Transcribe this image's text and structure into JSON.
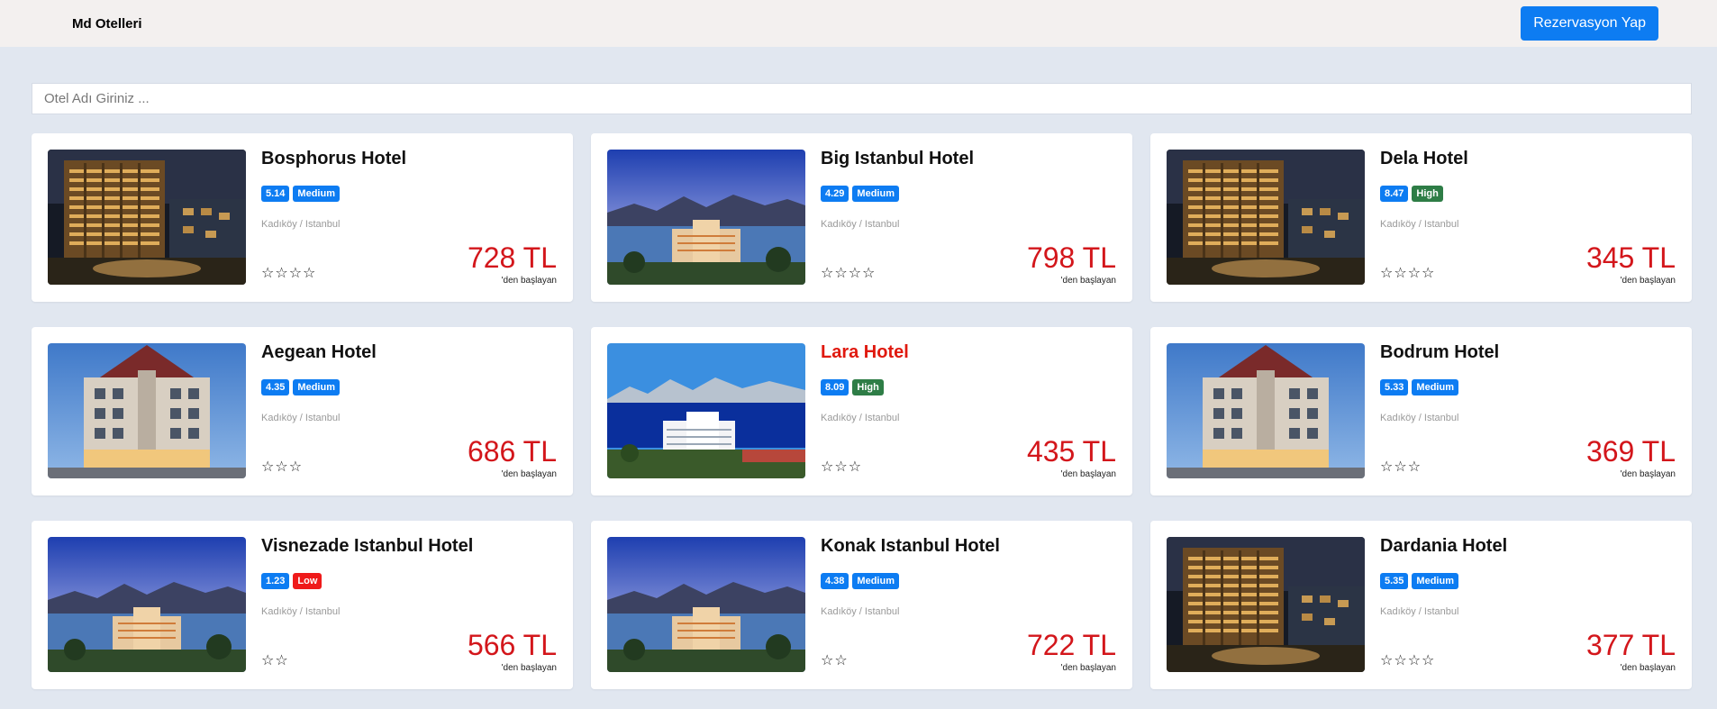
{
  "header": {
    "brand": "Md Otelleri",
    "cta_label": "Rezervasyon Yap"
  },
  "search": {
    "placeholder": "Otel Adı Giriniz ..."
  },
  "colors": {
    "primary": "#0d7cf2",
    "price": "#d3161b",
    "high": "#2e7d46",
    "low": "#ef1a1a"
  },
  "hotels": [
    {
      "name": "Bosphorus Hotel",
      "score": "5.14",
      "level": "Medium",
      "location": "Kadıköy / Istanbul",
      "stars": "☆☆☆☆",
      "price": "728 TL",
      "price_sub": "'den başlayan",
      "image": "hotel-night",
      "highlighted": false
    },
    {
      "name": "Big Istanbul Hotel",
      "score": "4.29",
      "level": "Medium",
      "location": "Kadıköy / Istanbul",
      "stars": "☆☆☆☆",
      "price": "798 TL",
      "price_sub": "'den başlayan",
      "image": "resort-sunset",
      "highlighted": false
    },
    {
      "name": "Dela Hotel",
      "score": "8.47",
      "level": "High",
      "location": "Kadıköy / Istanbul",
      "stars": "☆☆☆☆",
      "price": "345 TL",
      "price_sub": "'den başlayan",
      "image": "hotel-night",
      "highlighted": false
    },
    {
      "name": "Aegean Hotel",
      "score": "4.35",
      "level": "Medium",
      "location": "Kadıköy / Istanbul",
      "stars": "☆☆☆",
      "price": "686 TL",
      "price_sub": "'den başlayan",
      "image": "hotel-dusk",
      "highlighted": false
    },
    {
      "name": "Lara Hotel",
      "score": "8.09",
      "level": "High",
      "location": "Kadıköy / Istanbul",
      "stars": "☆☆☆",
      "price": "435 TL",
      "price_sub": "'den başlayan",
      "image": "coast-day",
      "highlighted": true
    },
    {
      "name": "Bodrum Hotel",
      "score": "5.33",
      "level": "Medium",
      "location": "Kadıköy / Istanbul",
      "stars": "☆☆☆",
      "price": "369 TL",
      "price_sub": "'den başlayan",
      "image": "hotel-dusk",
      "highlighted": false
    },
    {
      "name": "Visnezade Istanbul Hotel",
      "score": "1.23",
      "level": "Low",
      "location": "Kadıköy / Istanbul",
      "stars": "☆☆",
      "price": "566 TL",
      "price_sub": "'den başlayan",
      "image": "resort-sunset",
      "highlighted": false
    },
    {
      "name": "Konak Istanbul Hotel",
      "score": "4.38",
      "level": "Medium",
      "location": "Kadıköy / Istanbul",
      "stars": "☆☆",
      "price": "722 TL",
      "price_sub": "'den başlayan",
      "image": "resort-sunset",
      "highlighted": false
    },
    {
      "name": "Dardania Hotel",
      "score": "5.35",
      "level": "Medium",
      "location": "Kadıköy / Istanbul",
      "stars": "☆☆☆☆",
      "price": "377 TL",
      "price_sub": "'den başlayan",
      "image": "hotel-night",
      "highlighted": false
    }
  ]
}
